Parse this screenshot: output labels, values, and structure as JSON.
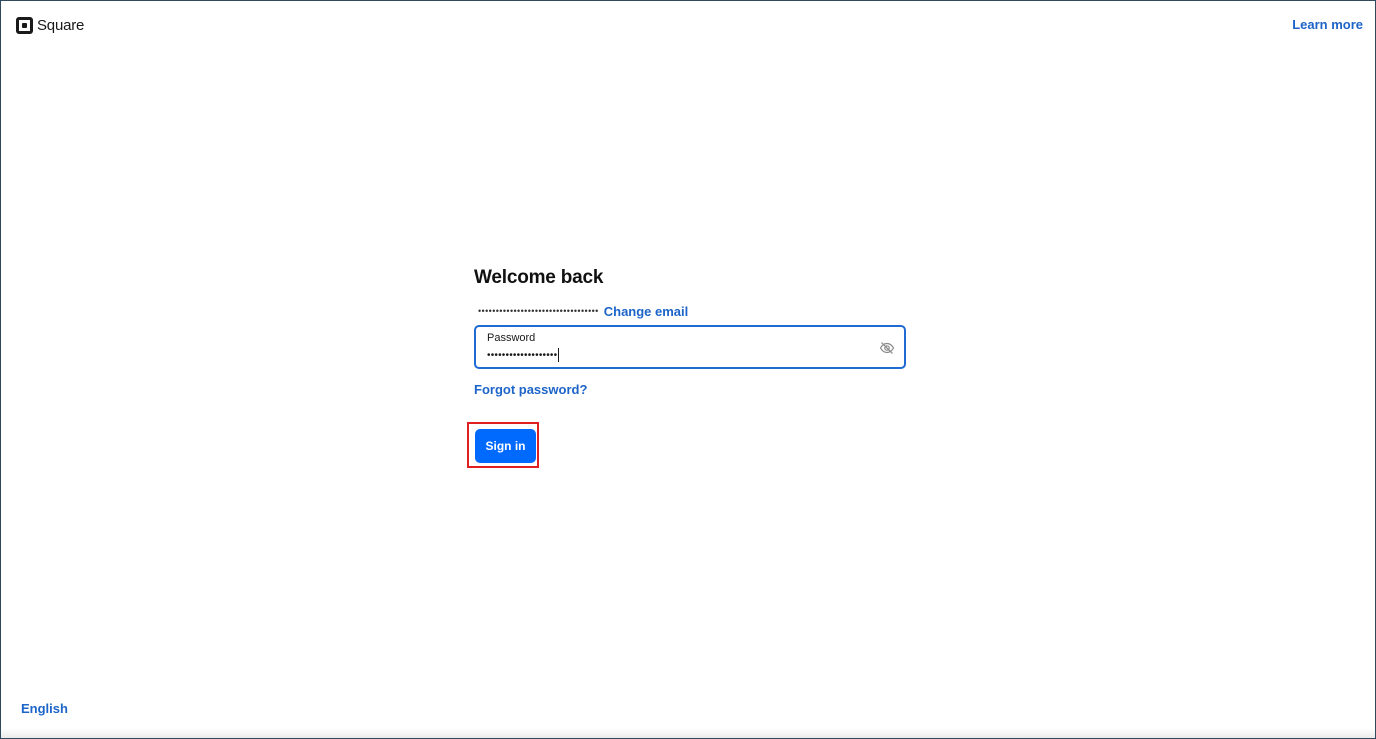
{
  "header": {
    "brand": "Square",
    "learn_more": "Learn more"
  },
  "form": {
    "title": "Welcome back",
    "masked_email": "••••••••••••••••••••••••••••••••••",
    "change_email": "Change email",
    "password_label": "Password",
    "password_value": "•••••••••••••••••••",
    "forgot_password": "Forgot password?",
    "sign_in": "Sign in"
  },
  "footer": {
    "language": "English"
  },
  "colors": {
    "link": "#1d64c8",
    "primary_button": "#006aff",
    "focus_border": "#1f6ad3",
    "highlight": "#e02020"
  },
  "icons": {
    "brand": "square-logo-icon",
    "password_toggle": "eye-off-icon"
  }
}
